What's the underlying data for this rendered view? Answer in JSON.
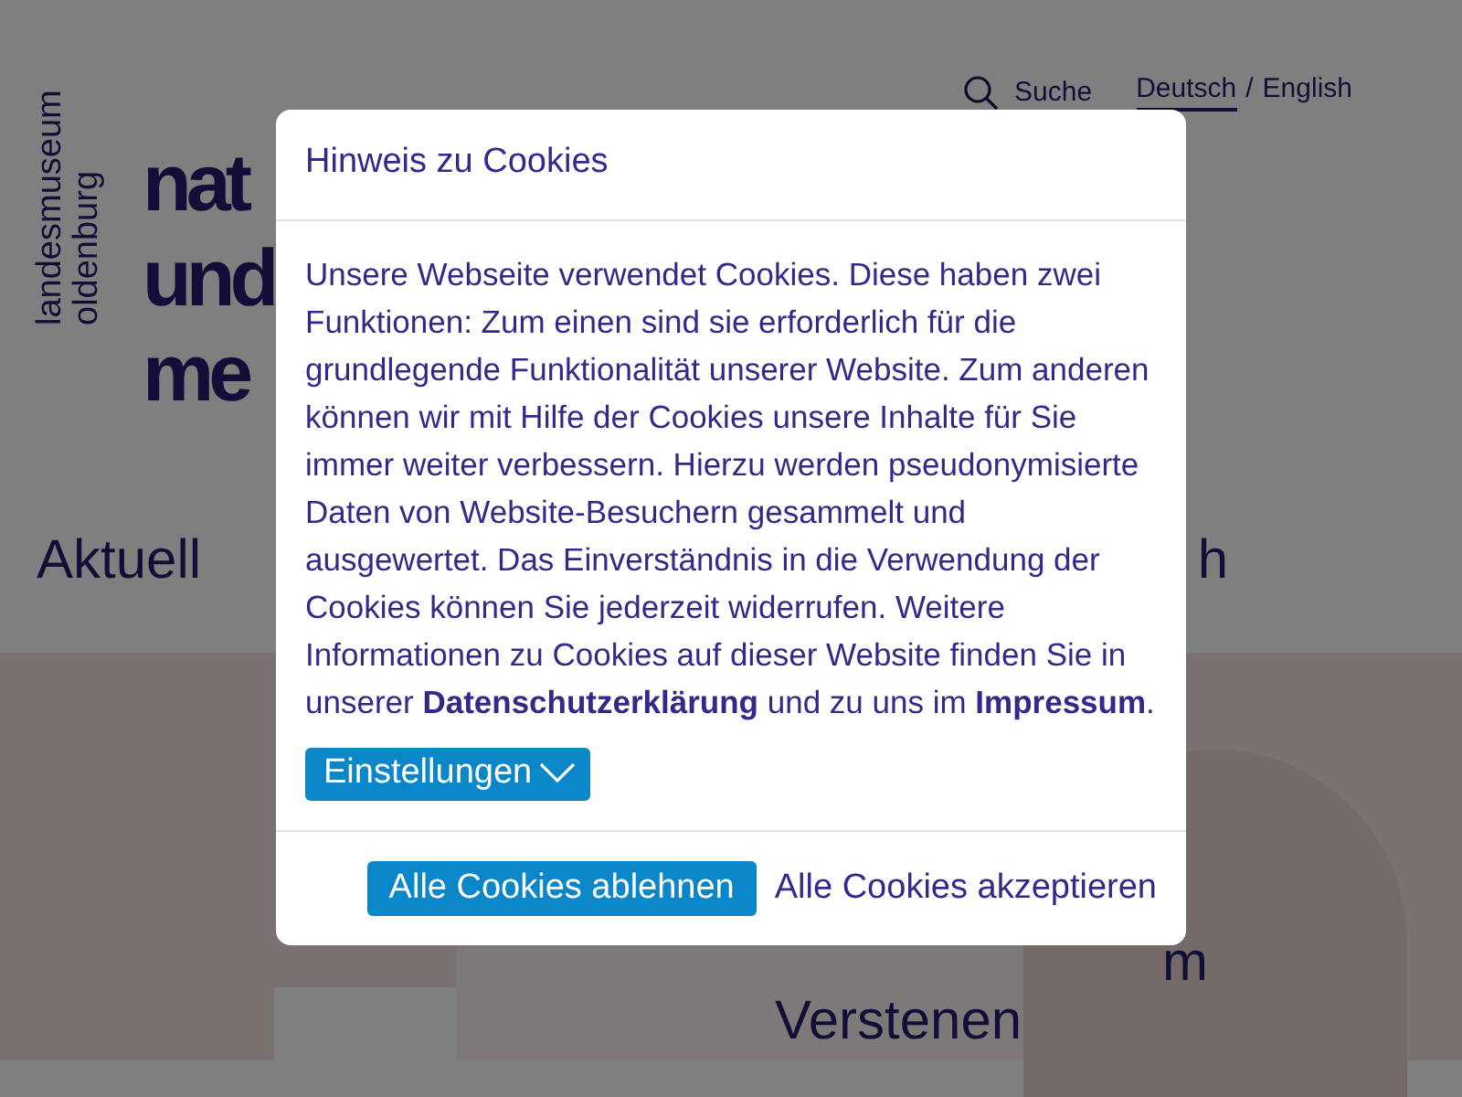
{
  "site": {
    "logo_lines": [
      "landesmuseum",
      "oldenburg"
    ],
    "search": "Suche",
    "languages": [
      {
        "label": "Deutsch",
        "selected": true
      },
      {
        "label": "English",
        "selected": false
      }
    ],
    "separator": "/",
    "headline": [
      "nat",
      "und",
      "me"
    ],
    "nav": [
      "Aktuell",
      "h"
    ],
    "teaser": [
      "m",
      "Verstenen"
    ]
  },
  "dialog": {
    "title": "Hinweis zu Cookies",
    "text": "Unsere Webseite verwendet Cookies. Diese haben zwei Funktionen: Zum einen sind sie erforderlich für die grundlegende Funktionalität unserer Website. Zum anderen können wir mit Hilfe der Cookies unsere Inhalte für Sie immer weiter verbessern. Hierzu werden pseudonymisierte Daten von Website-Besuchern gesammelt und ausgewertet. Das Einverständnis in die Verwendung der Cookies können Sie jederzeit widerrufen. Weitere Informationen zu Cookies auf dieser Website finden Sie in unserer **Datenschutzerklärung** und zu uns im **Impressum**.",
    "settings_button": "Einstellungen",
    "expanded": false,
    "buttons": [
      {
        "label": "Alle Cookies ablehnen",
        "kind": "primary"
      },
      {
        "label": "Alle Cookies akzeptieren",
        "kind": "link"
      }
    ]
  }
}
